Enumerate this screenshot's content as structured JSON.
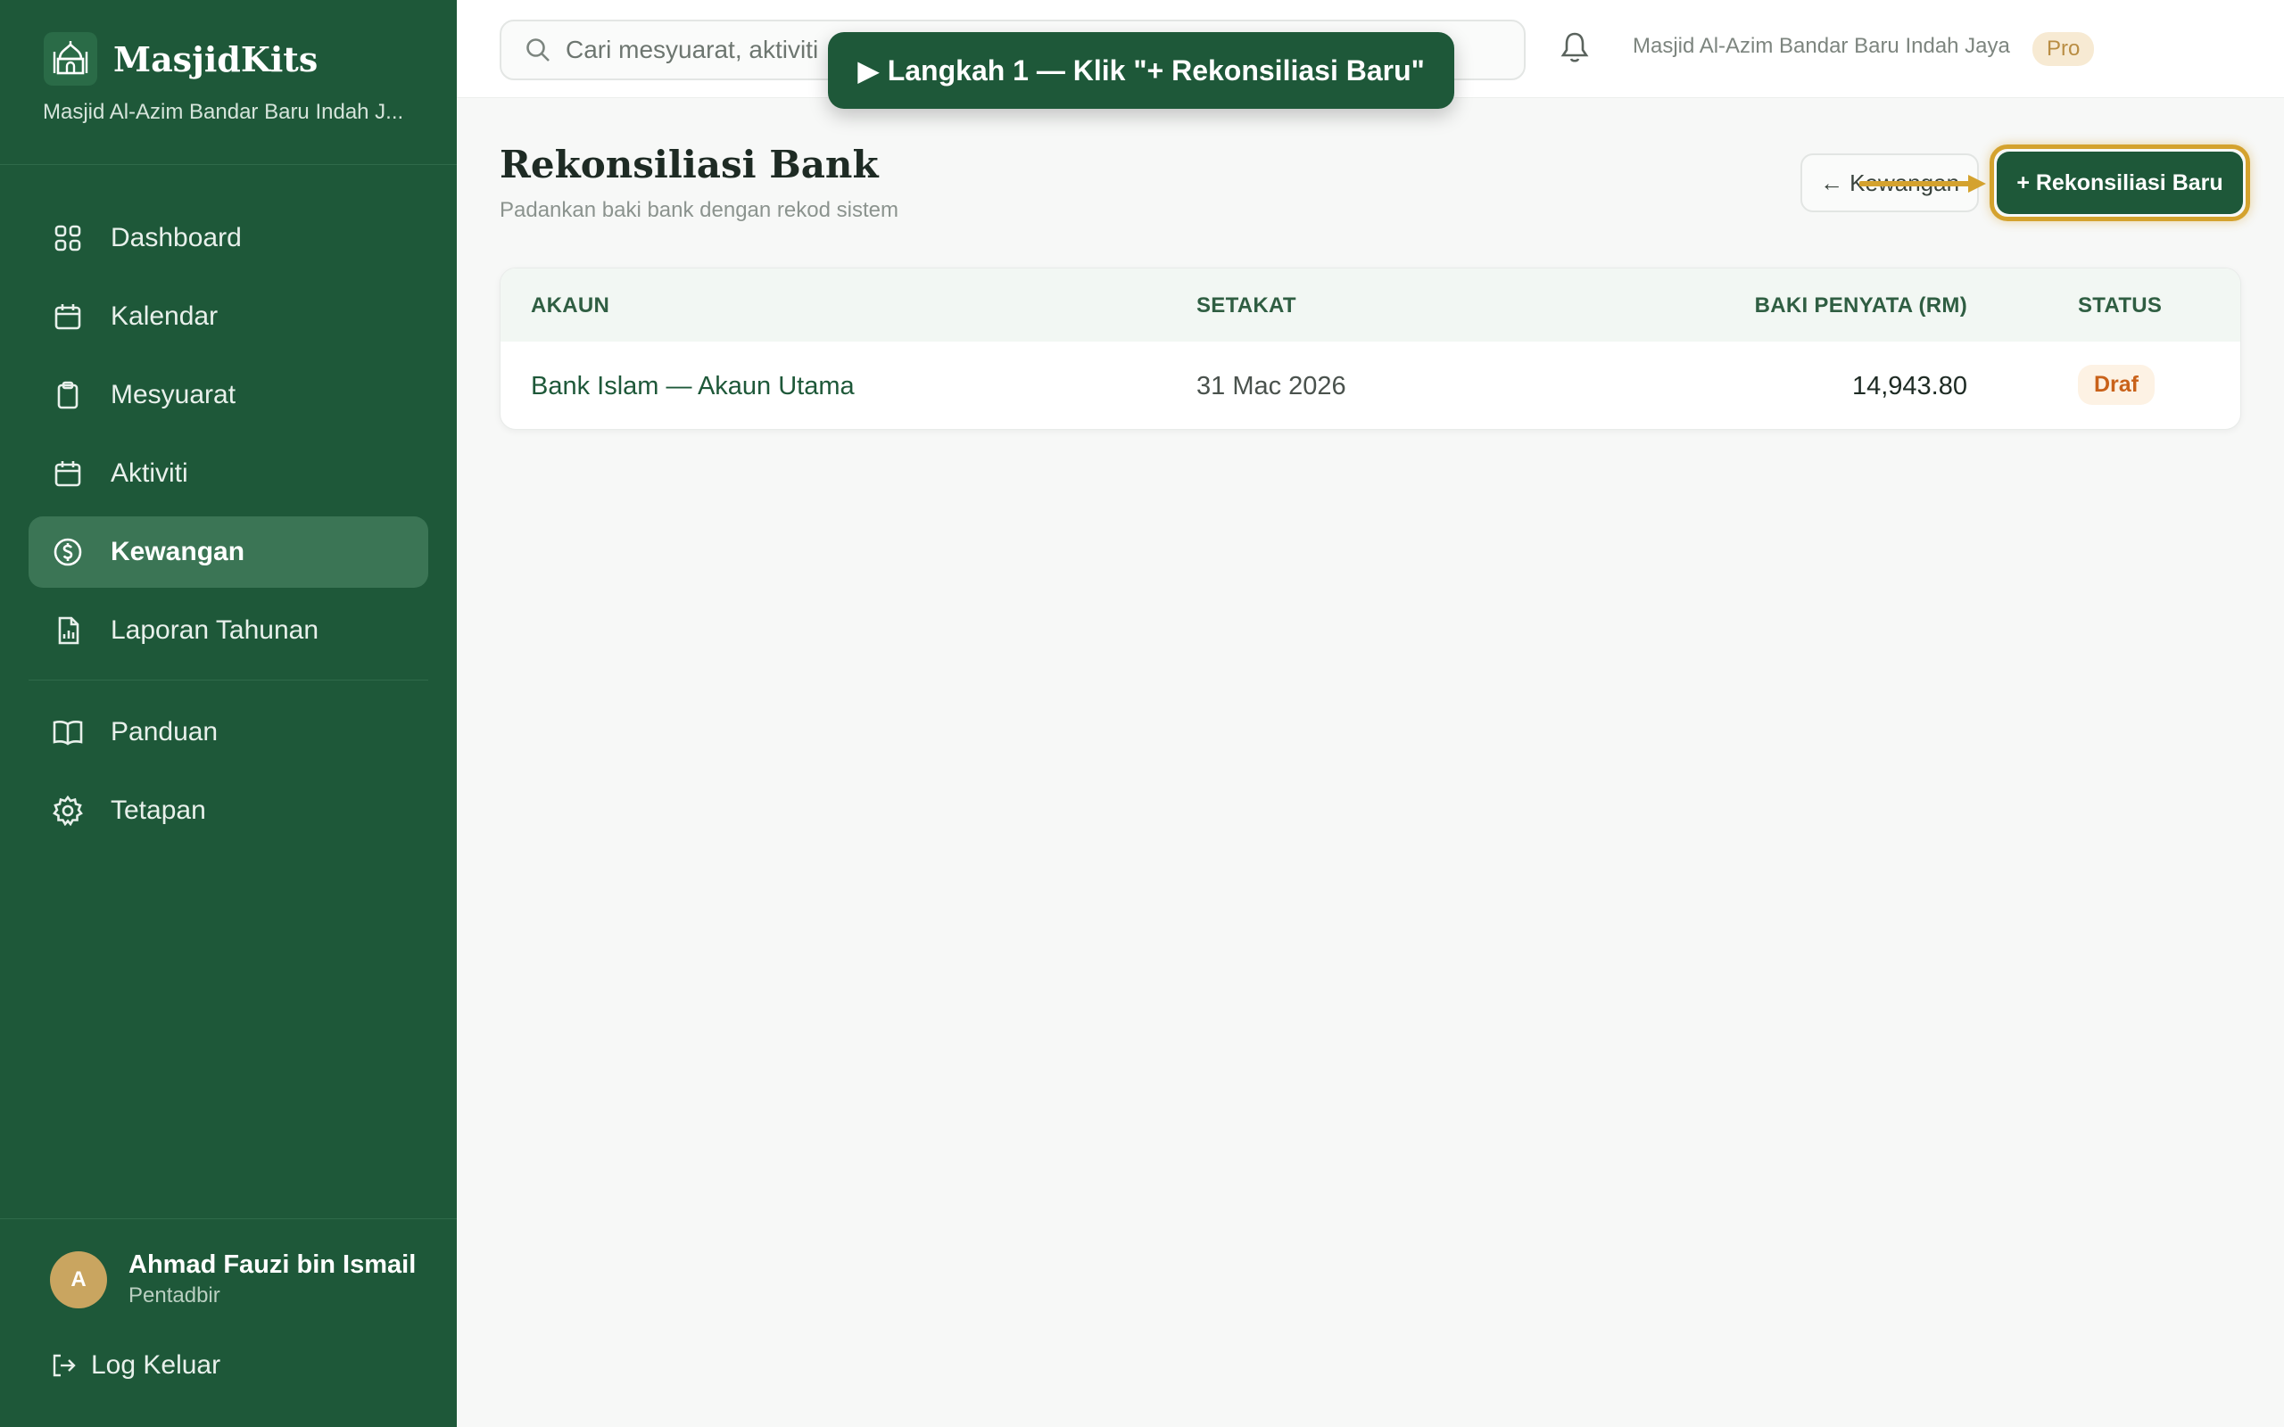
{
  "sidebar": {
    "brand_name": "MasjidKits",
    "brand_sub": "Masjid Al-Azim Bandar Baru Indah J...",
    "nav": [
      {
        "label": "Dashboard",
        "icon": "grid-icon"
      },
      {
        "label": "Kalendar",
        "icon": "calendar-icon"
      },
      {
        "label": "Mesyuarat",
        "icon": "clipboard-icon"
      },
      {
        "label": "Aktiviti",
        "icon": "calendar-icon"
      },
      {
        "label": "Kewangan",
        "icon": "dollar-circle-icon",
        "active": true
      },
      {
        "label": "Laporan Tahunan",
        "icon": "report-icon"
      }
    ],
    "nav_secondary": [
      {
        "label": "Panduan",
        "icon": "book-icon"
      },
      {
        "label": "Tetapan",
        "icon": "gear-icon"
      }
    ],
    "user": {
      "initial": "A",
      "name": "Ahmad Fauzi bin Ismail",
      "role": "Pentadbir"
    },
    "logout_label": "Log Keluar"
  },
  "topbar": {
    "search_placeholder": "Cari mesyuarat, aktiviti",
    "org_name": "Masjid Al-Azim Bandar Baru Indah Jaya",
    "plan_badge": "Pro"
  },
  "tour": {
    "text": "▶ Langkah 1 — Klik \"+ Rekonsiliasi Baru\""
  },
  "page": {
    "title": "Rekonsiliasi Bank",
    "subtitle": "Padankan baki bank dengan rekod sistem",
    "back_label": "← Kewangan",
    "new_label": "+ Rekonsiliasi Baru"
  },
  "table": {
    "headers": {
      "account": "AKAUN",
      "as_of": "SETAKAT",
      "balance": "BAKI PENYATA (RM)",
      "status": "STATUS"
    },
    "rows": [
      {
        "account": "Bank Islam — Akaun Utama",
        "as_of": "31 Mac 2026",
        "balance": "14,943.80",
        "status": "Draf"
      }
    ]
  },
  "colors": {
    "brand_green": "#1e5839",
    "active_nav": "#3b7555",
    "highlight_gold": "#d4a22e",
    "draft_badge": "#c9621a"
  }
}
